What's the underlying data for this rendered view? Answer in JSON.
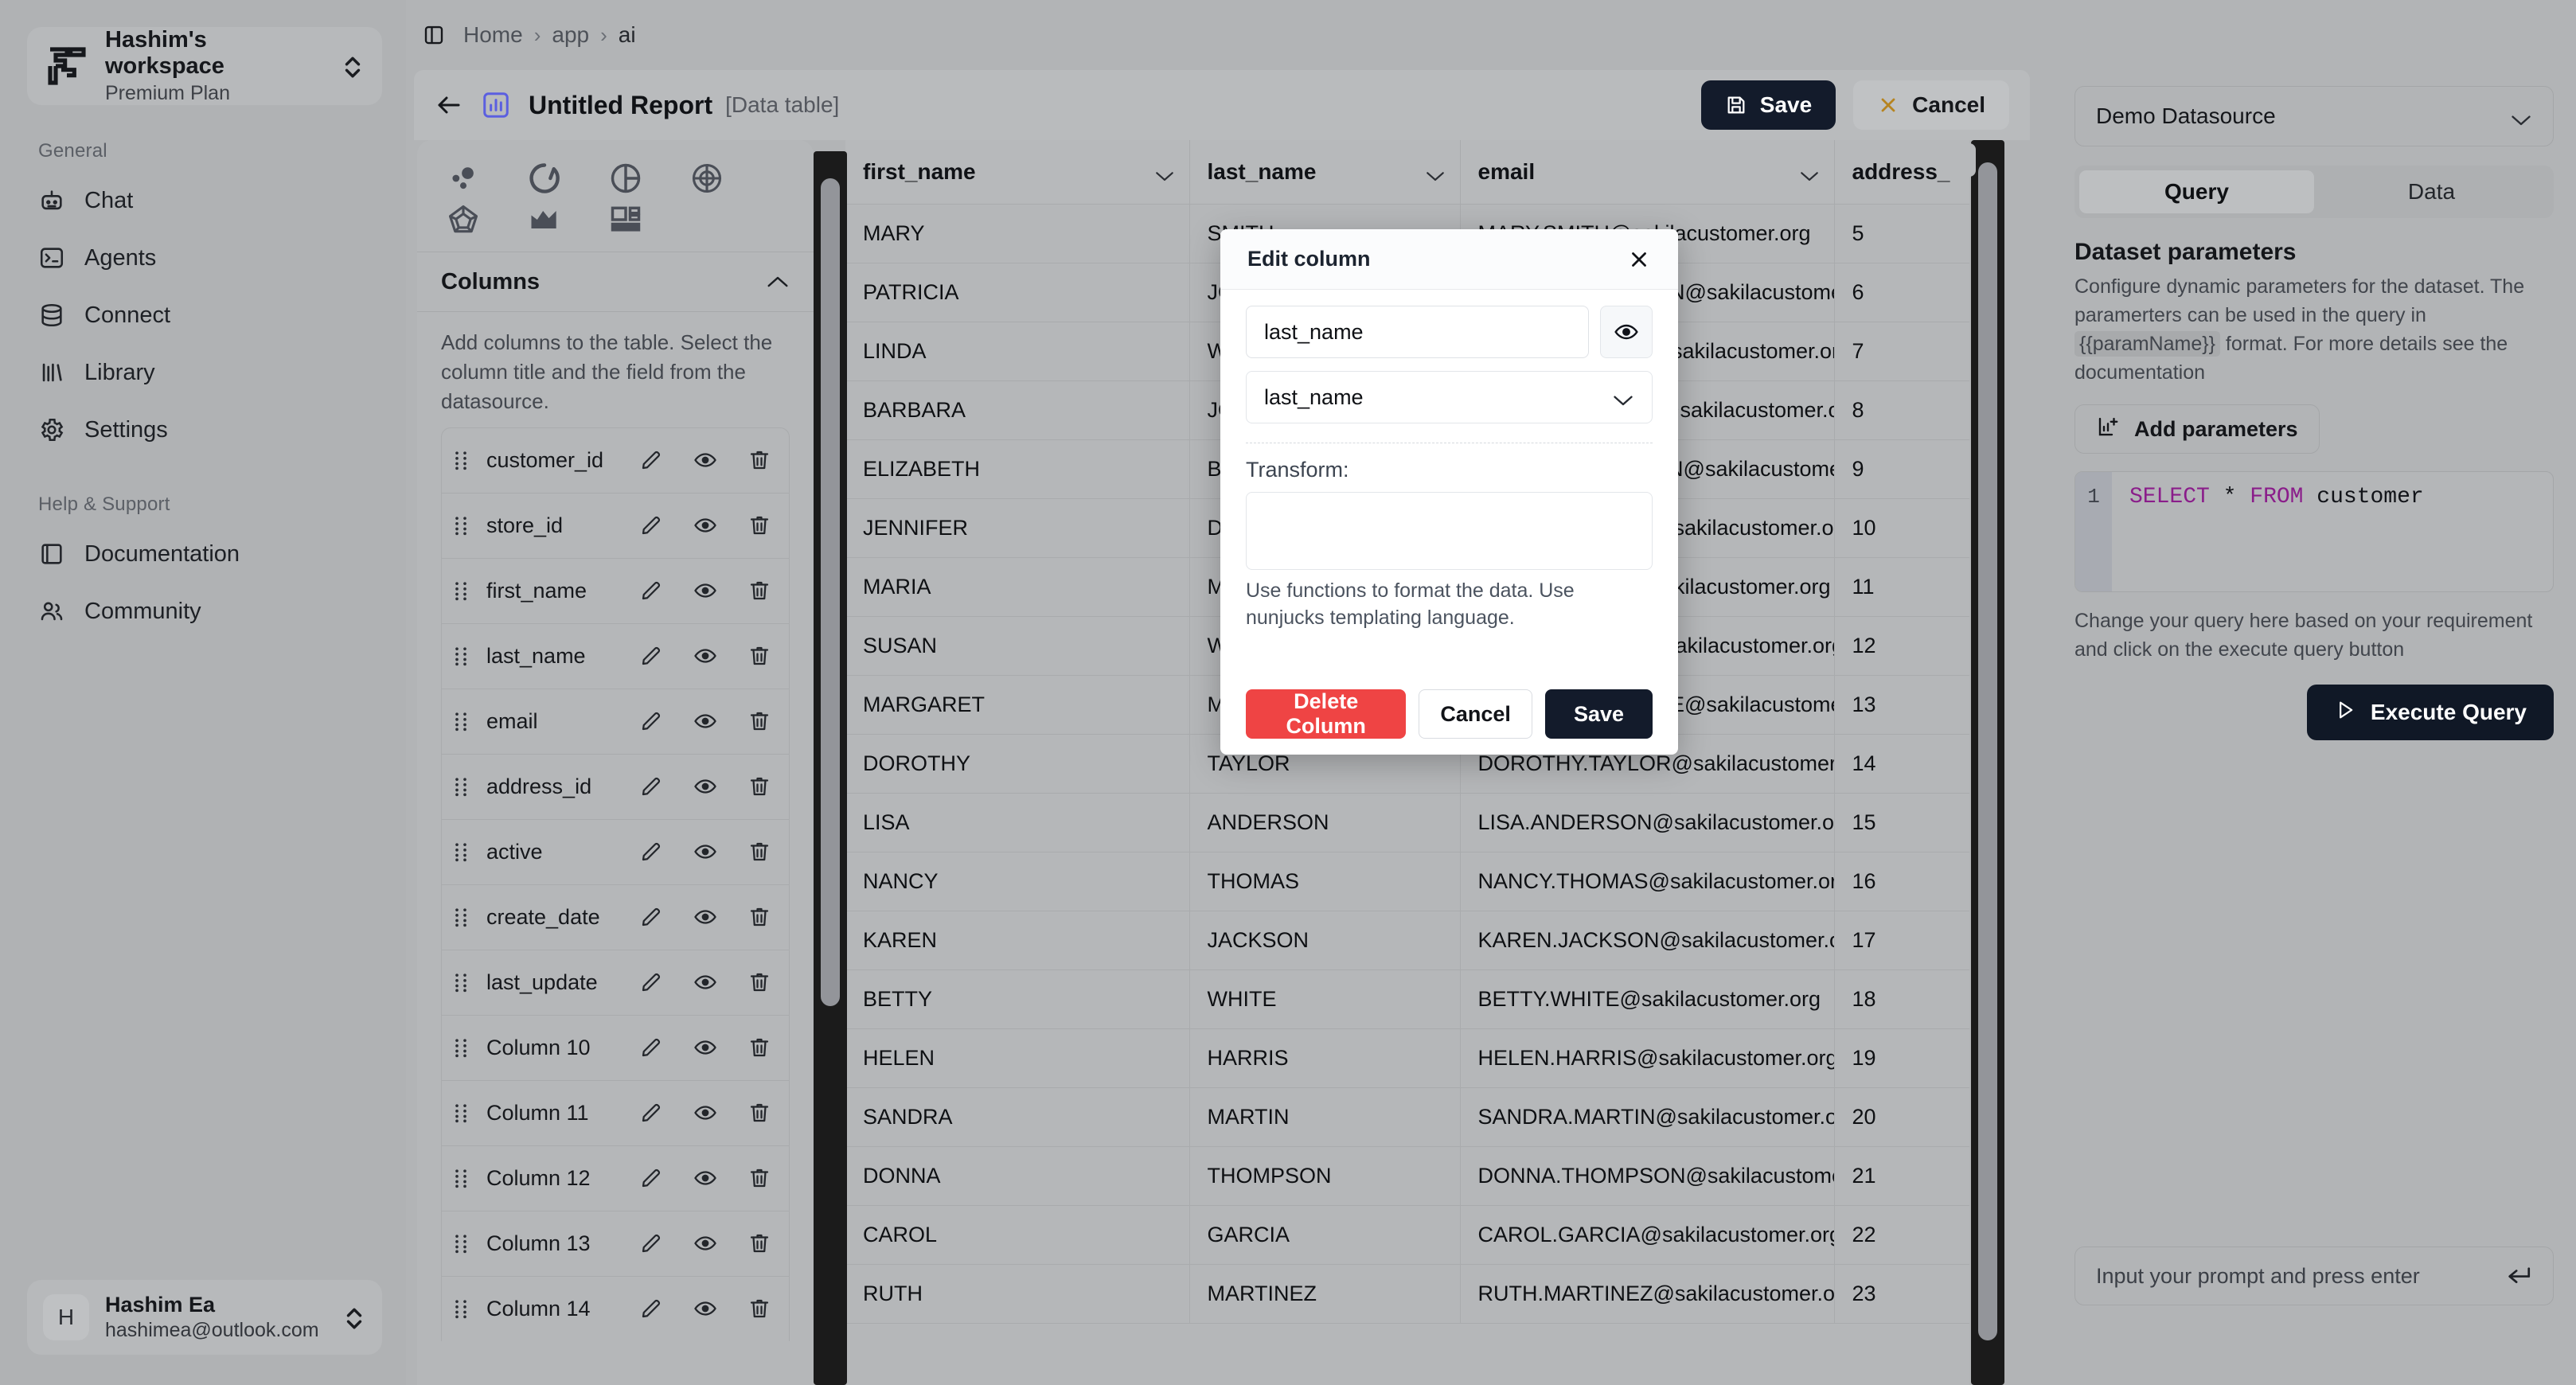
{
  "workspace": {
    "name": "Hashim's workspace",
    "plan": "Premium Plan"
  },
  "sidebar": {
    "section_general": "General",
    "section_help": "Help & Support",
    "general_items": [
      {
        "label": "Chat",
        "icon": "robot-icon"
      },
      {
        "label": "Agents",
        "icon": "terminal-icon"
      },
      {
        "label": "Connect",
        "icon": "database-icon"
      },
      {
        "label": "Library",
        "icon": "bars-icon"
      },
      {
        "label": "Settings",
        "icon": "gear-icon"
      }
    ],
    "help_items": [
      {
        "label": "Documentation",
        "icon": "book-icon"
      },
      {
        "label": "Community",
        "icon": "users-icon"
      }
    ]
  },
  "user": {
    "initial": "H",
    "name": "Hashim Ea",
    "email": "hashimea@outlook.com"
  },
  "breadcrumb": {
    "items": [
      "Home",
      "app",
      "ai"
    ],
    "separator": "›"
  },
  "report": {
    "title": "Untitled Report",
    "type": "[Data table]",
    "save_label": "Save",
    "cancel_label": "Cancel"
  },
  "left_panel": {
    "chart_types": [
      "scatter-chart-icon",
      "donut-chart-icon",
      "pie-chart-icon",
      "radar-chart-icon",
      "polygon-chart-icon",
      "area-chart-icon",
      "data-table-icon"
    ],
    "columns_header": "Columns",
    "columns_description": "Add columns to the table. Select the column title and the field from the datasource.",
    "columns": [
      "customer_id",
      "store_id",
      "first_name",
      "last_name",
      "email",
      "address_id",
      "active",
      "create_date",
      "last_update",
      "Column 10",
      "Column 11",
      "Column 12",
      "Column 13",
      "Column 14"
    ],
    "row_actions": [
      "edit-icon",
      "eye-icon",
      "trash-icon"
    ]
  },
  "table": {
    "headers": [
      "first_name",
      "last_name",
      "email",
      "address_"
    ],
    "rows": [
      [
        "MARY",
        "SMITH",
        "MARY.SMITH@sakilacustomer.org",
        "5"
      ],
      [
        "PATRICIA",
        "JOHNSON",
        "PATRICIA.JOHNSON@sakilacustomer.org",
        "6"
      ],
      [
        "LINDA",
        "WILLIAMS",
        "LINDA.WILLIAMS@sakilacustomer.org",
        "7"
      ],
      [
        "BARBARA",
        "JONES",
        "BARBARA.JONES@sakilacustomer.org",
        "8"
      ],
      [
        "ELIZABETH",
        "BROWN",
        "ELIZABETH.BROWN@sakilacustomer.org",
        "9"
      ],
      [
        "JENNIFER",
        "DAVIS",
        "JENNIFER.DAVIS@sakilacustomer.org",
        "10"
      ],
      [
        "MARIA",
        "MILLER",
        "MARIA.MILLER@sakilacustomer.org",
        "11"
      ],
      [
        "SUSAN",
        "WILSON",
        "SUSAN.WILSON@sakilacustomer.org",
        "12"
      ],
      [
        "MARGARET",
        "MOORE",
        "MARGARET.MOORE@sakilacustomer.org",
        "13"
      ],
      [
        "DOROTHY",
        "TAYLOR",
        "DOROTHY.TAYLOR@sakilacustomer.org",
        "14"
      ],
      [
        "LISA",
        "ANDERSON",
        "LISA.ANDERSON@sakilacustomer.org",
        "15"
      ],
      [
        "NANCY",
        "THOMAS",
        "NANCY.THOMAS@sakilacustomer.org",
        "16"
      ],
      [
        "KAREN",
        "JACKSON",
        "KAREN.JACKSON@sakilacustomer.org",
        "17"
      ],
      [
        "BETTY",
        "WHITE",
        "BETTY.WHITE@sakilacustomer.org",
        "18"
      ],
      [
        "HELEN",
        "HARRIS",
        "HELEN.HARRIS@sakilacustomer.org",
        "19"
      ],
      [
        "SANDRA",
        "MARTIN",
        "SANDRA.MARTIN@sakilacustomer.org",
        "20"
      ],
      [
        "DONNA",
        "THOMPSON",
        "DONNA.THOMPSON@sakilacustomer.org",
        "21"
      ],
      [
        "CAROL",
        "GARCIA",
        "CAROL.GARCIA@sakilacustomer.org",
        "22"
      ],
      [
        "RUTH",
        "MARTINEZ",
        "RUTH.MARTINEZ@sakilacustomer.org",
        "23"
      ]
    ]
  },
  "right_panel": {
    "datasource": "Demo Datasource",
    "tabs": [
      {
        "label": "Query",
        "active": true
      },
      {
        "label": "Data",
        "active": false
      }
    ],
    "params_title": "Dataset parameters",
    "params_desc_1": "Configure dynamic parameters for the dataset. The paramerters can be used in the query in",
    "params_code": "{{paramName}}",
    "params_desc_2": "format. For more details see the documentation",
    "add_params_label": "Add parameters",
    "query": {
      "line_number": "1",
      "keyword_1": "SELECT",
      "star": "*",
      "keyword_2": "FROM",
      "identifier": "customer"
    },
    "query_hint": "Change your query here based on your requirement and click on the execute query button",
    "execute_label": "Execute Query",
    "prompt_placeholder": "Input your prompt and press enter"
  },
  "modal": {
    "title": "Edit column",
    "name_value": "last_name",
    "field_value": "last_name",
    "transform_label": "Transform:",
    "transform_value": "",
    "transform_hint": "Use functions to format the data. Use nunjucks templating language.",
    "delete_label": "Delete Column",
    "cancel_label": "Cancel",
    "save_label": "Save"
  },
  "colors": {
    "accent": "#5b5fe0",
    "danger": "#ef4444",
    "dark": "#131b2b",
    "amber": "#b68420"
  }
}
